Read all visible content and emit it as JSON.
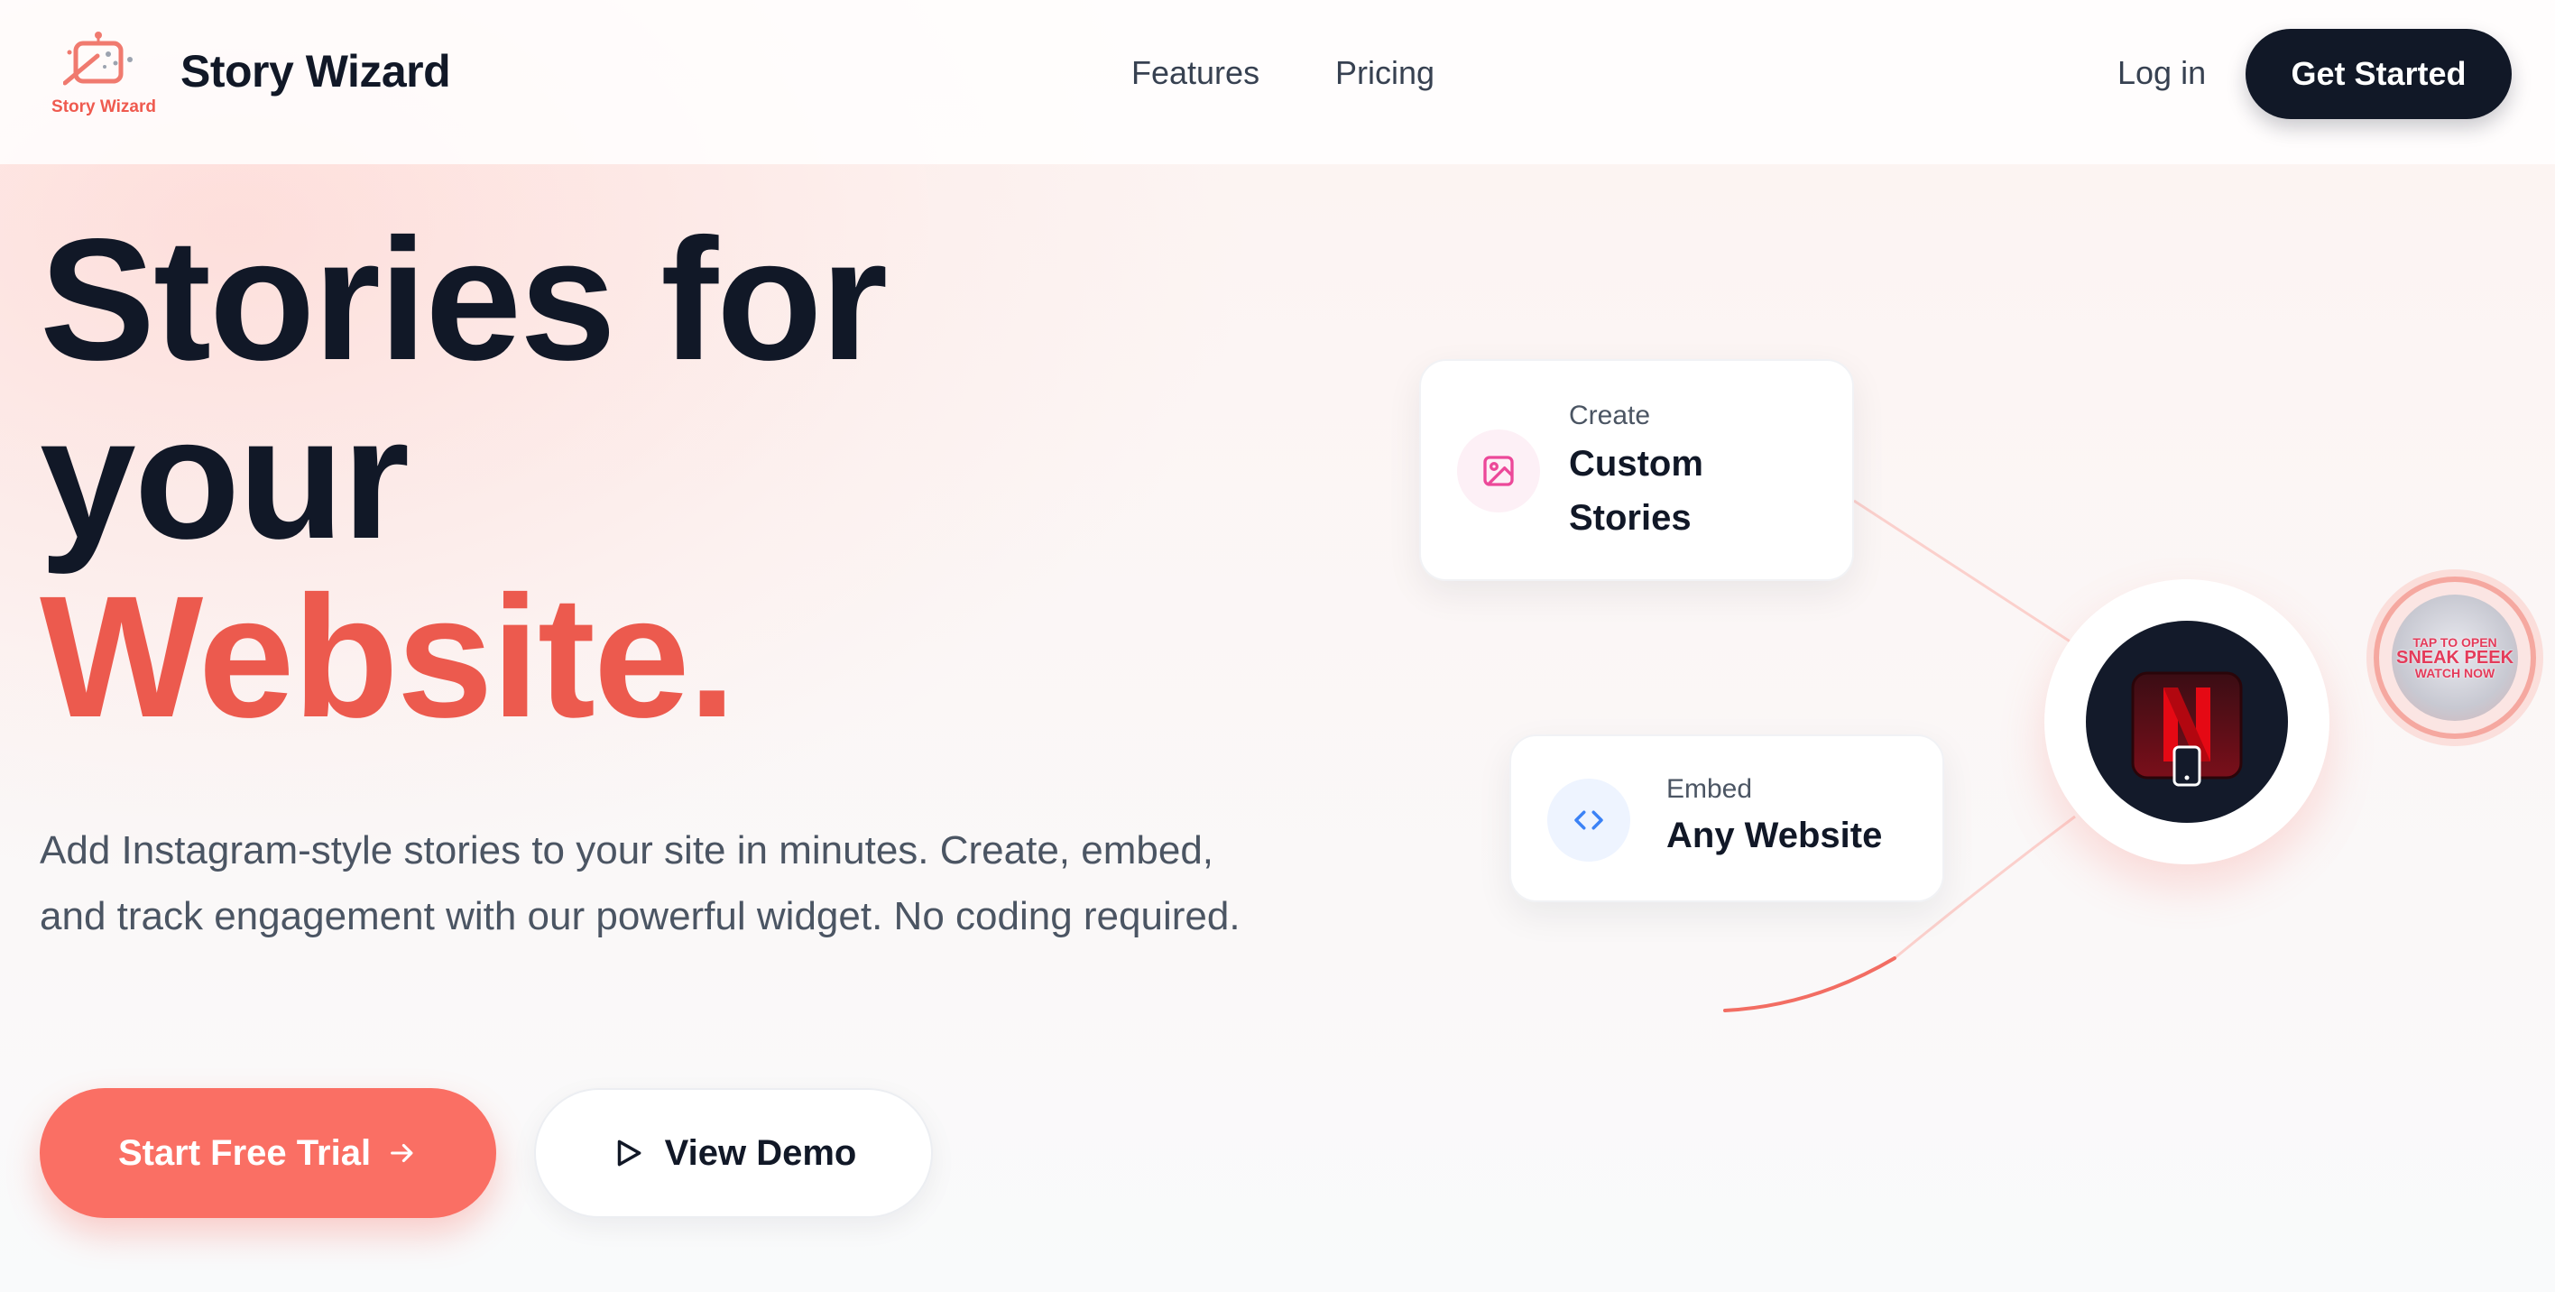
{
  "brand": {
    "name": "Story Wizard",
    "logo_caption": "Story Wizard",
    "accent_color": "#ec5a4e"
  },
  "nav": {
    "features": "Features",
    "pricing": "Pricing",
    "login": "Log in",
    "get_started": "Get Started"
  },
  "hero": {
    "line1": "Stories for",
    "line2": "your",
    "line3": "Website.",
    "subtitle": "Add Instagram-style stories to your site in minutes. Create, embed, and track engagement with our powerful widget. No coding required.",
    "cta_primary": "Start Free Trial",
    "cta_secondary": "View Demo"
  },
  "cards": {
    "create": {
      "kicker": "Create",
      "title_line1": "Custom",
      "title_line2": "Stories",
      "icon": "image-icon"
    },
    "embed": {
      "kicker": "Embed",
      "title": "Any Website",
      "icon": "code-icon"
    }
  },
  "story_bubble": {
    "line1": "TAP TO OPEN",
    "line2": "SNEAK PEEK",
    "line3": "WATCH NOW"
  },
  "icons": {
    "arrow": "arrow-right-icon",
    "play": "play-icon",
    "phone": "phone-icon",
    "brand_mark": "netflix-n-icon"
  }
}
